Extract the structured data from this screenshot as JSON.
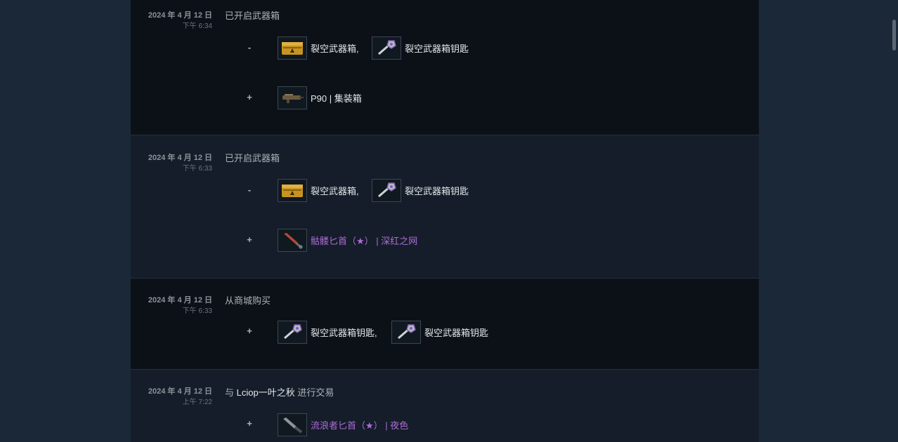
{
  "history": [
    {
      "date": "2024 年 4 月 12 日",
      "time": "下午 6:34",
      "description": "已开启武器箱",
      "groups": [
        {
          "sign": "-",
          "items": [
            {
              "name": "裂空武器箱,",
              "icon": "weapon-case-icon",
              "rarity": "normal"
            },
            {
              "name": "裂空武器箱钥匙",
              "icon": "case-key-icon",
              "rarity": "normal"
            }
          ]
        },
        {
          "sign": "+",
          "items": [
            {
              "name": "P90 | 集装箱",
              "icon": "p90-rifle-icon",
              "rarity": "normal"
            }
          ]
        }
      ]
    },
    {
      "date": "2024 年 4 月 12 日",
      "time": "下午 6:33",
      "description": "已开启武器箱",
      "groups": [
        {
          "sign": "-",
          "items": [
            {
              "name": "裂空武器箱,",
              "icon": "weapon-case-icon",
              "rarity": "normal"
            },
            {
              "name": "裂空武器箱钥匙",
              "icon": "case-key-icon",
              "rarity": "normal"
            }
          ]
        },
        {
          "sign": "+",
          "items": [
            {
              "name": "骷髅匕首（★） | 深红之网",
              "icon": "skeleton-knife-icon",
              "rarity": "covert"
            }
          ]
        }
      ]
    },
    {
      "date": "2024 年 4 月 12 日",
      "time": "下午 6:33",
      "description": "从商城购买",
      "groups": [
        {
          "sign": "+",
          "items": [
            {
              "name": "裂空武器箱钥匙,",
              "icon": "case-key-icon",
              "rarity": "normal"
            },
            {
              "name": "裂空武器箱钥匙",
              "icon": "case-key-icon",
              "rarity": "normal"
            }
          ]
        }
      ]
    },
    {
      "date": "2024 年 4 月 12 日",
      "time": "上午 7:22",
      "description_prefix": "与 ",
      "partner": "Lciop一叶之秋",
      "description_suffix": " 进行交易",
      "groups": [
        {
          "sign": "+",
          "items": [
            {
              "name": "流浪者匕首（★） | 夜色",
              "icon": "nomad-knife-icon",
              "rarity": "covert"
            }
          ]
        }
      ]
    }
  ],
  "colors": {
    "covert": "#b06bd8",
    "normal_text": "#e4e7ea",
    "page_bg": "#1b2838"
  }
}
